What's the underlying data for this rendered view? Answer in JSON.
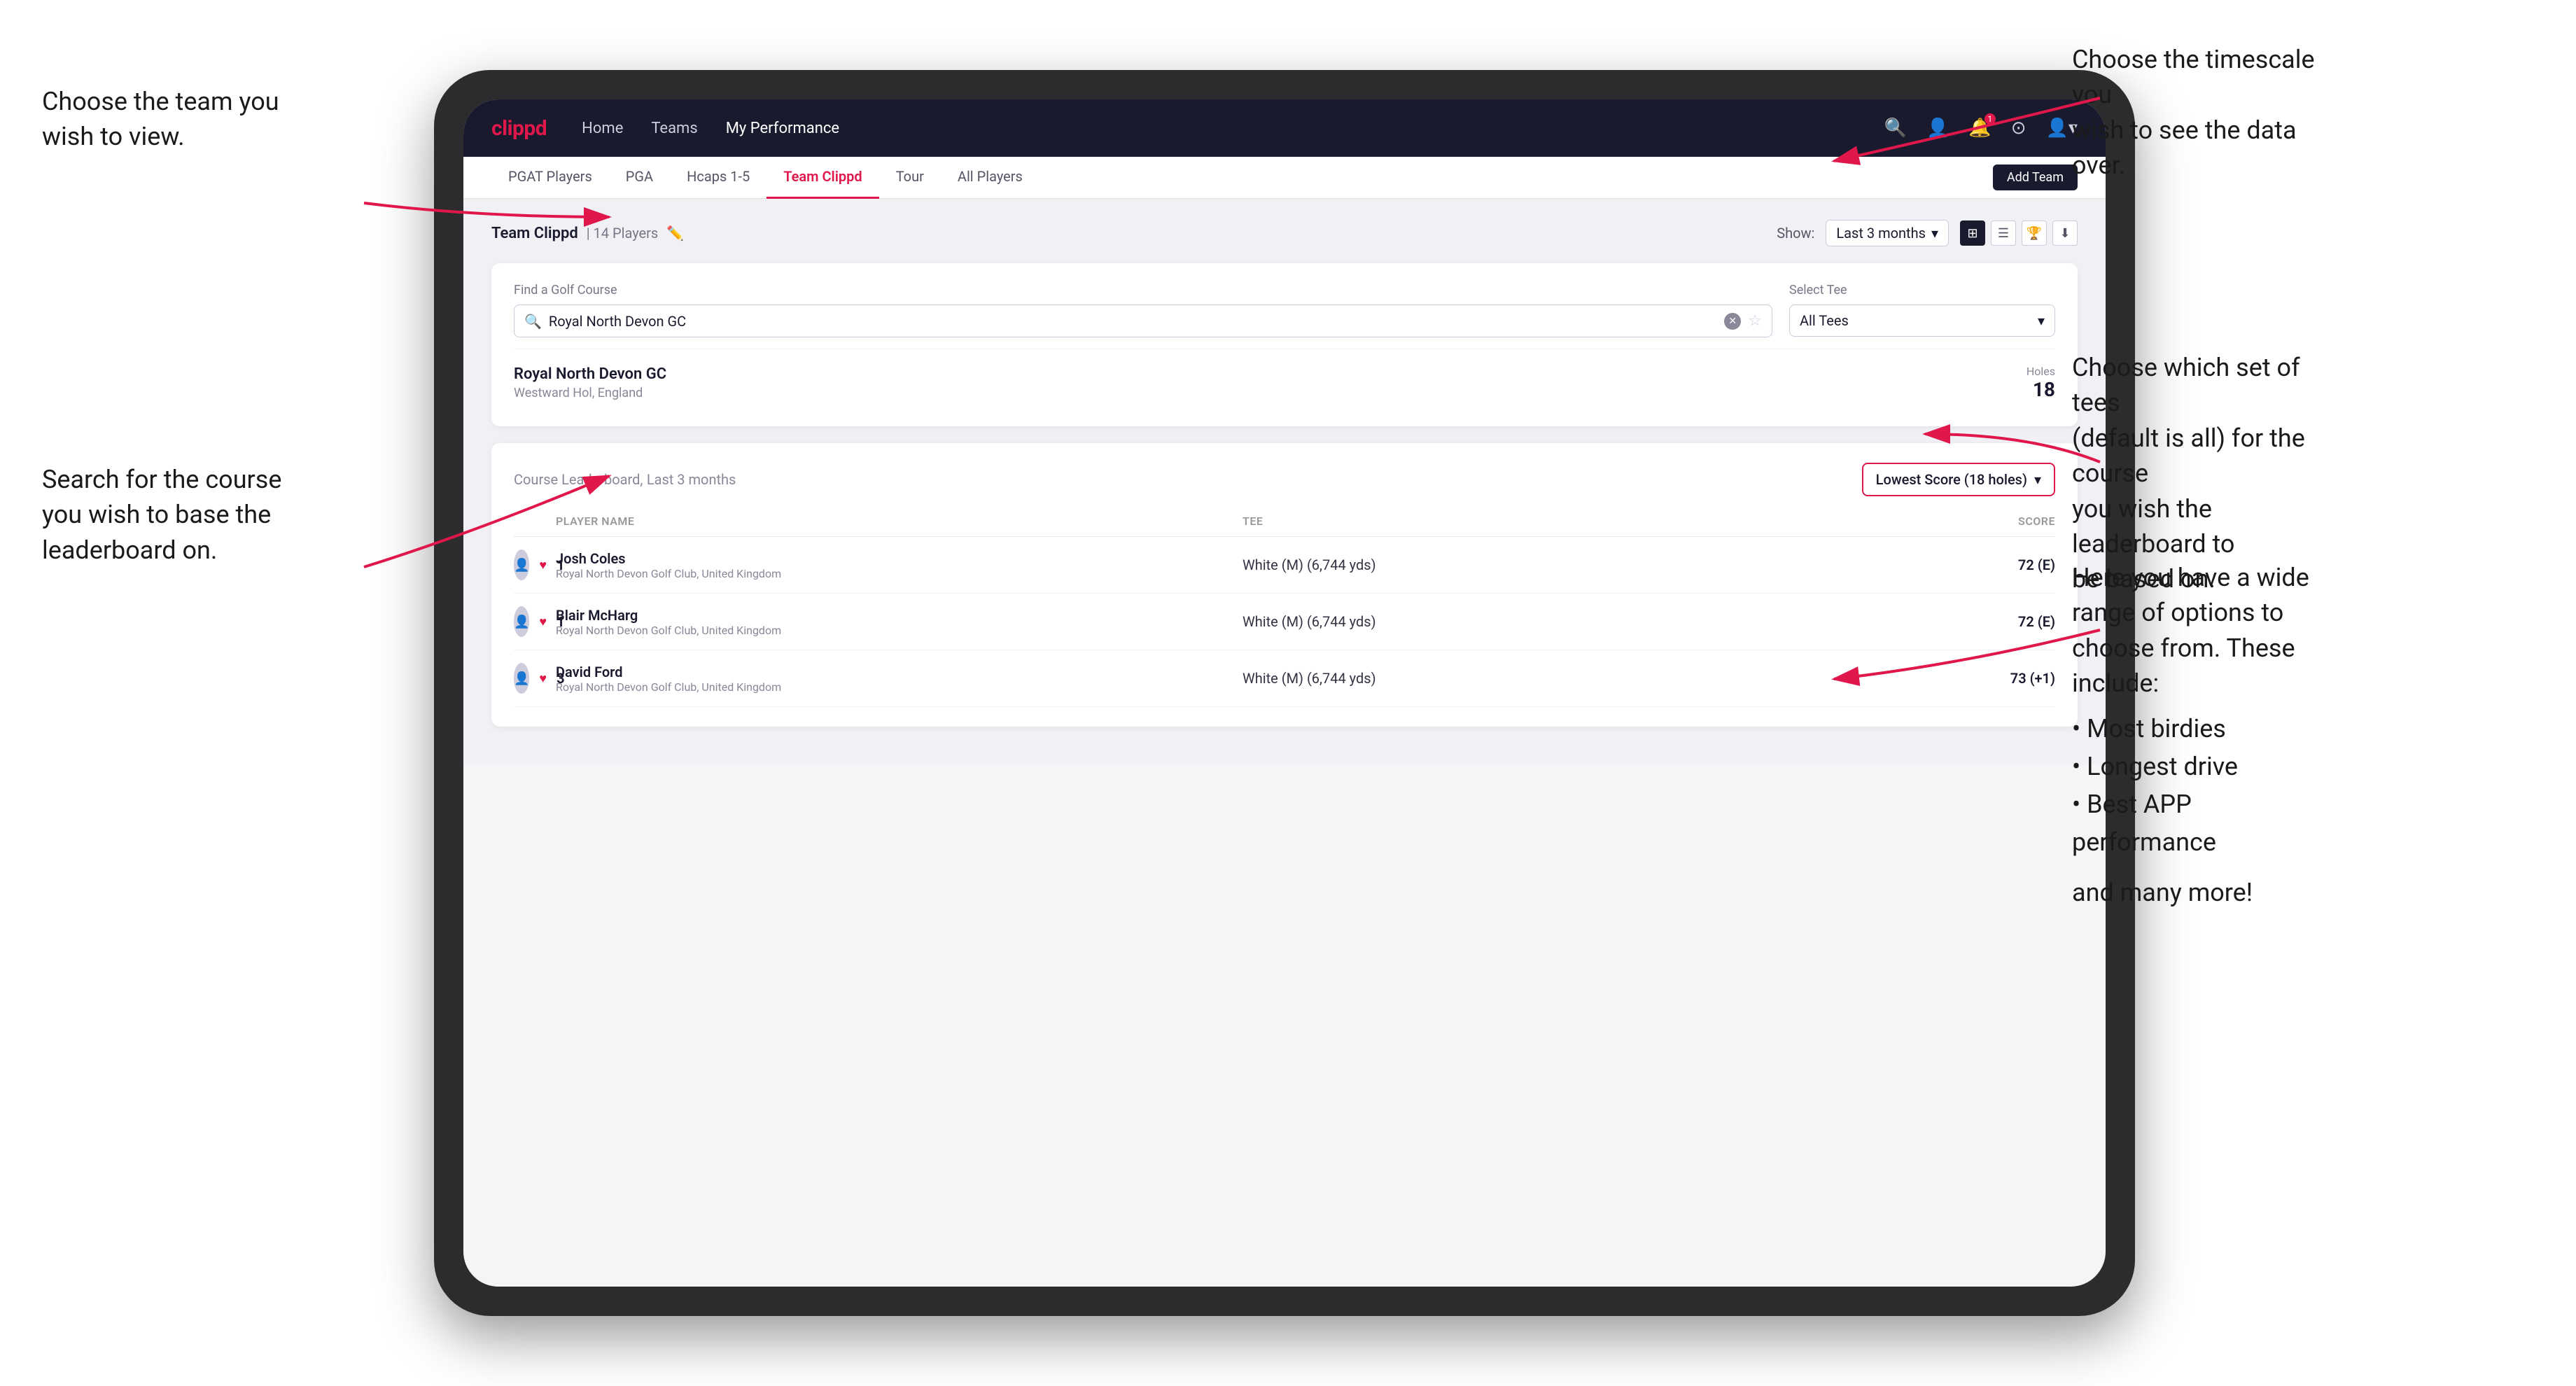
{
  "annotations": {
    "top_left": {
      "line1": "Choose the team you",
      "line2": "wish to view."
    },
    "top_right": {
      "line1": "Choose the timescale you",
      "line2": "wish to see the data over."
    },
    "mid_left": {
      "line1": "Search for the course",
      "line2": "you wish to base the",
      "line3": "leaderboard on."
    },
    "mid_right": {
      "line1": "Choose which set of tees",
      "line2": "(default is all) for the course",
      "line3": "you wish the leaderboard to",
      "line4": "be based on."
    },
    "bot_right": {
      "intro": "Here you have a wide range of options to choose from. These include:",
      "bullets": [
        "Most birdies",
        "Longest drive",
        "Best APP performance"
      ],
      "outro": "and many more!"
    }
  },
  "nav": {
    "logo": "clippd",
    "links": [
      "Home",
      "Teams",
      "My Performance"
    ],
    "active_link": "My Performance"
  },
  "sub_nav": {
    "items": [
      "PGAT Players",
      "PGA",
      "Hcaps 1-5",
      "Team Clippd",
      "Tour",
      "All Players"
    ],
    "active": "Team Clippd",
    "add_team_btn": "Add Team"
  },
  "team_header": {
    "title": "Team Clippd",
    "count": "14 Players",
    "show_label": "Show:",
    "show_value": "Last 3 months"
  },
  "search": {
    "find_label": "Find a Golf Course",
    "find_placeholder": "Royal North Devon GC",
    "tee_label": "Select Tee",
    "tee_value": "All Tees"
  },
  "course": {
    "name": "Royal North Devon GC",
    "location": "Westward Hol, England",
    "holes_label": "Holes",
    "holes_count": "18"
  },
  "leaderboard": {
    "title": "Course Leaderboard,",
    "period": "Last 3 months",
    "score_filter": "Lowest Score (18 holes)",
    "columns": {
      "player": "PLAYER NAME",
      "tee": "TEE",
      "score": "SCORE"
    },
    "rows": [
      {
        "rank": "1",
        "name": "Josh Coles",
        "club": "Royal North Devon Golf Club, United Kingdom",
        "tee": "White (M) (6,744 yds)",
        "score": "72 (E)"
      },
      {
        "rank": "1",
        "name": "Blair McHarg",
        "club": "Royal North Devon Golf Club, United Kingdom",
        "tee": "White (M) (6,744 yds)",
        "score": "72 (E)"
      },
      {
        "rank": "3",
        "name": "David Ford",
        "club": "Royal North Devon Golf Club, United Kingdom",
        "tee": "White (M) (6,744 yds)",
        "score": "73 (+1)"
      }
    ]
  }
}
